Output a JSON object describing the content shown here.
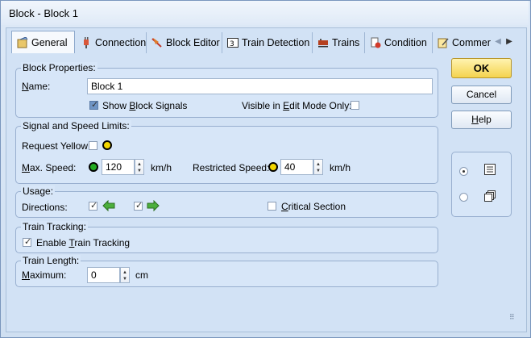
{
  "window": {
    "title": "Block - Block 1"
  },
  "tabs": [
    {
      "label": "General",
      "icon": "general-icon",
      "active": true
    },
    {
      "label": "Connection",
      "icon": "connection-icon"
    },
    {
      "label": "Block Editor",
      "icon": "block-editor-icon"
    },
    {
      "label": "Train Detection",
      "icon": "train-detection-icon"
    },
    {
      "label": "Trains",
      "icon": "trains-icon"
    },
    {
      "label": "Condition",
      "icon": "condition-icon"
    },
    {
      "label": "Commer",
      "icon": "comment-icon"
    }
  ],
  "block_properties": {
    "legend": "Block Properties:",
    "name_label": "Name:",
    "name_value": "Block 1",
    "show_signals_label": "Show Block Signals",
    "show_signals_checked": true,
    "visible_edit_label": "Visible in Edit Mode Only:",
    "visible_edit_checked": false
  },
  "signal_speed": {
    "legend": "Signal and Speed Limits:",
    "request_yellow_label": "Request Yellow:",
    "request_yellow_checked": false,
    "max_speed_label": "Max. Speed:",
    "max_speed_value": "120",
    "max_speed_unit": "km/h",
    "restricted_label": "Restricted Speed:",
    "restricted_value": "40",
    "restricted_unit": "km/h",
    "colors": {
      "green": "#22aa22",
      "yellow": "#f2d600"
    }
  },
  "usage": {
    "legend": "Usage:",
    "directions_label": "Directions:",
    "left_checked": true,
    "right_checked": true,
    "critical_label": "Critical Section",
    "critical_checked": false
  },
  "train_tracking": {
    "legend": "Train Tracking:",
    "enable_label": "Enable Train Tracking",
    "enable_checked": true
  },
  "train_length": {
    "legend": "Train Length:",
    "maximum_label": "Maximum:",
    "maximum_value": "0",
    "unit": "cm"
  },
  "buttons": {
    "ok": "OK",
    "cancel": "Cancel",
    "help": "Help"
  },
  "view_options": {
    "selected": "list"
  }
}
